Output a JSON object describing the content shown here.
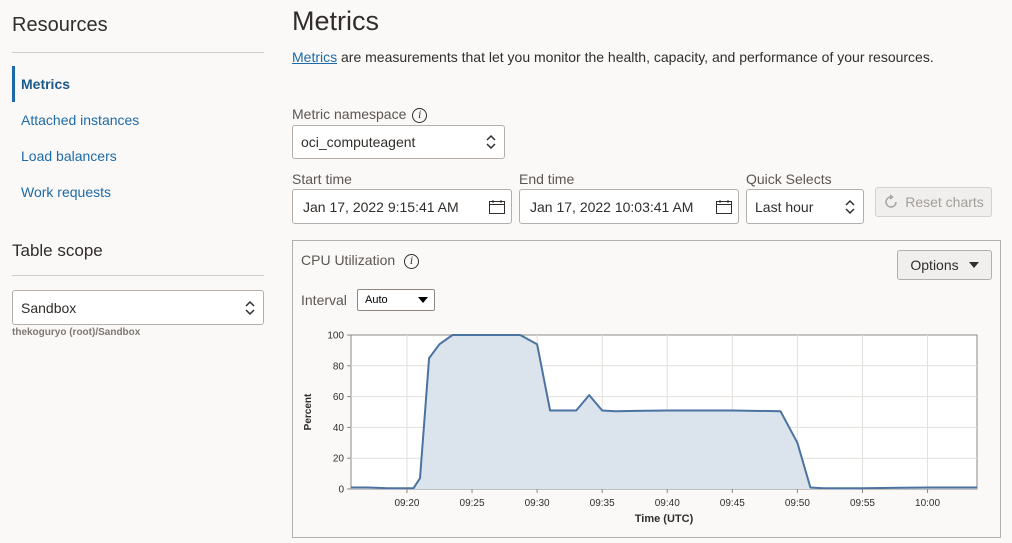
{
  "sidebar": {
    "resources_heading": "Resources",
    "items": [
      {
        "label": "Metrics",
        "active": true
      },
      {
        "label": "Attached instances",
        "active": false
      },
      {
        "label": "Load balancers",
        "active": false
      },
      {
        "label": "Work requests",
        "active": false
      }
    ],
    "table_scope_heading": "Table scope",
    "scope_value": "Sandbox",
    "scope_path": "thekoguryo (root)/Sandbox"
  },
  "main": {
    "title": "Metrics",
    "intro_link": "Metrics",
    "intro_text": " are measurements that let you monitor the health, capacity, and performance of your resources.",
    "namespace_label": "Metric namespace",
    "namespace_value": "oci_computeagent",
    "start_label": "Start time",
    "start_value": "Jan 17, 2022 9:15:41 AM",
    "end_label": "End time",
    "end_value": "Jan 17, 2022 10:03:41 AM",
    "quick_label": "Quick Selects",
    "quick_value": "Last hour",
    "reset_label": "Reset charts"
  },
  "chart_panel": {
    "title": "CPU Utilization",
    "options_label": "Options",
    "interval_label": "Interval",
    "interval_value": "Auto"
  },
  "colors": {
    "accent": "#1c6aa8",
    "series_line": "#4a73a1",
    "series_fill": "#dbe3ec"
  },
  "chart_data": {
    "type": "area",
    "xlabel": "Time (UTC)",
    "ylabel": "Percent",
    "ylim": [
      0,
      100
    ],
    "yticks": [
      0,
      20,
      40,
      60,
      80,
      100
    ],
    "x_tick_labels": [
      "09:20",
      "09:25",
      "09:30",
      "09:35",
      "09:40",
      "09:45",
      "09:50",
      "09:55",
      "10:00"
    ],
    "x_range_minutes": [
      15.7,
      63.8
    ],
    "grid": true,
    "series": [
      {
        "x": [
          15.7,
          17.0,
          18.5,
          19.5,
          20.5,
          21.0,
          21.7,
          22.5,
          23.5,
          24.5,
          25.5,
          26.5,
          27.5,
          28.7,
          30.0,
          31.0,
          32.0,
          33.0,
          34.0,
          35.0,
          36.0,
          40.0,
          45.0,
          48.7,
          50.0,
          51.0,
          52.0,
          55.0,
          60.0,
          63.8
        ],
        "y": [
          1,
          1,
          0.5,
          0.5,
          0.5,
          7,
          85,
          94,
          100,
          100,
          100,
          100,
          100,
          100,
          94,
          51,
          51,
          51,
          61,
          51,
          50.5,
          51,
          51,
          50.5,
          30,
          1,
          0.5,
          0.5,
          1,
          1
        ]
      }
    ]
  }
}
